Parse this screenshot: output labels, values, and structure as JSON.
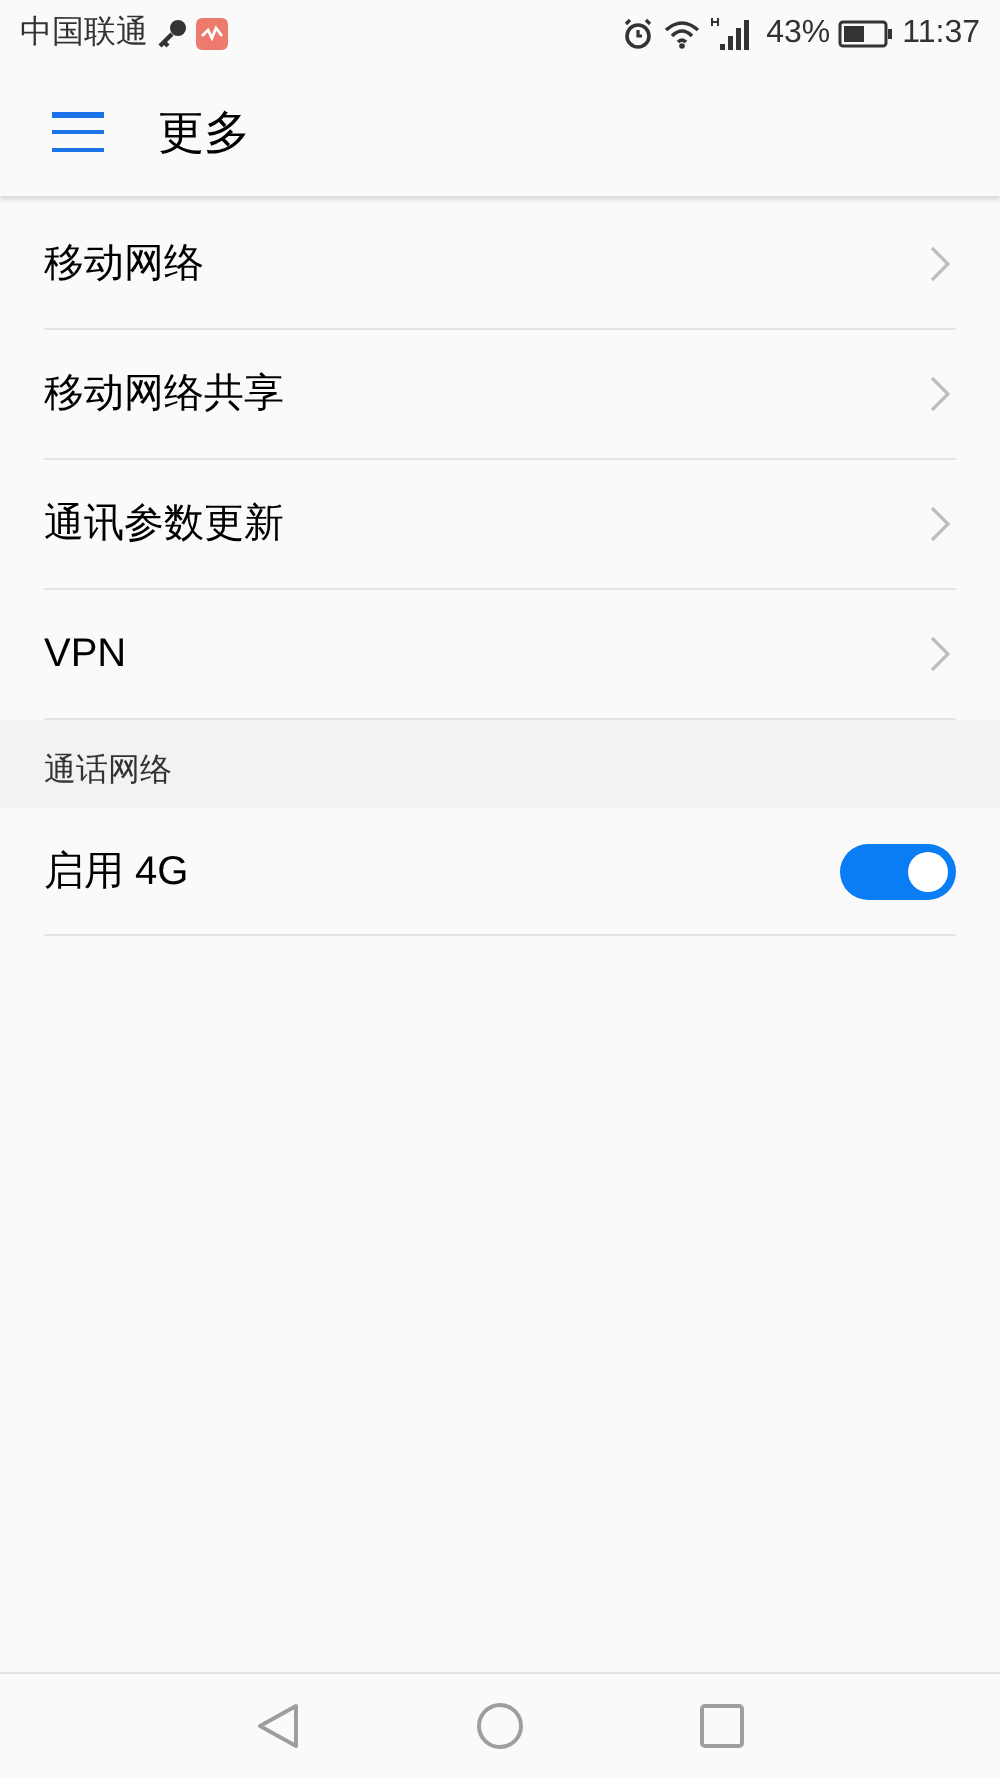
{
  "status_bar": {
    "carrier": "中国联通",
    "battery": "43%",
    "time": "11:37"
  },
  "header": {
    "title": "更多"
  },
  "items": [
    {
      "label": "移动网络"
    },
    {
      "label": "移动网络共享"
    },
    {
      "label": "通讯参数更新"
    },
    {
      "label": "VPN"
    }
  ],
  "section": {
    "title": "通话网络",
    "items": [
      {
        "label": "启用 4G",
        "on": true
      }
    ]
  }
}
